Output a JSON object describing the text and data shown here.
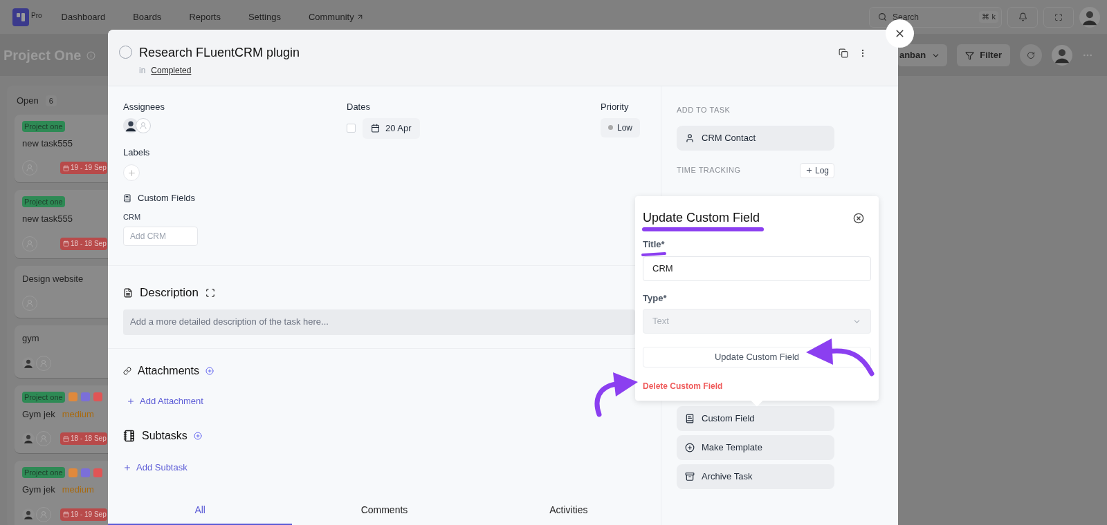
{
  "nav": {
    "logo_badge": "Pro",
    "items": [
      {
        "label": "Dashboard",
        "external": false
      },
      {
        "label": "Boards",
        "external": false
      },
      {
        "label": "Reports",
        "external": false
      },
      {
        "label": "Settings",
        "external": false
      },
      {
        "label": "Community",
        "external": true
      }
    ],
    "search": {
      "placeholder": "Search",
      "shortcut": "⌘ k"
    }
  },
  "project": {
    "title": "Project One",
    "view": "anban",
    "filter": "Filter"
  },
  "board": {
    "column": {
      "title": "Open",
      "count": "6",
      "cards": [
        {
          "tag": "Project one",
          "title": "new task555",
          "date": "19 - 19 Sep",
          "assigned": false
        },
        {
          "tag": "Project one",
          "title": "new task555",
          "date": "18 - 18 Sep",
          "assigned": false
        },
        {
          "title": "Design website",
          "assigned": false
        },
        {
          "title": "gym",
          "assigned": true
        },
        {
          "tag": "Project one",
          "labels": [
            {
              "color": "#e0893c"
            },
            {
              "color": "#7b6fd8"
            },
            {
              "color": "#e05555"
            }
          ],
          "title": "Gym jek",
          "priority": "medium",
          "date": "18 - 18 Sep",
          "assigned": true
        },
        {
          "tag": "Project one",
          "labels": [
            {
              "color": "#e0893c"
            },
            {
              "color": "#7b6fd8"
            },
            {
              "color": "#e05555"
            }
          ],
          "title": "Gym jek",
          "priority": "medium",
          "date": "19 - 19 Sep",
          "assigned": true
        }
      ]
    }
  },
  "task": {
    "title": "Research FLuentCRM plugin",
    "completed": false,
    "list_prefix": "in",
    "list": "Completed",
    "assignees": {
      "label": "Assignees",
      "assigned": true
    },
    "dates": {
      "label": "Dates",
      "checked": false,
      "value": "20 Apr"
    },
    "priority": {
      "label": "Priority",
      "value": "Low"
    },
    "labels": {
      "label": "Labels"
    },
    "custom_fields": {
      "heading": "Custom Fields",
      "field_label": "CRM",
      "placeholder": "Add CRM"
    },
    "description": {
      "heading": "Description",
      "placeholder": "Add a more detailed description of the task here..."
    },
    "attachments": {
      "heading": "Attachments",
      "action": "Add Attachment"
    },
    "subtasks": {
      "heading": "Subtasks",
      "action": "Add Subtask"
    },
    "tabs": [
      {
        "label": "All",
        "selected": true
      },
      {
        "label": "Comments",
        "selected": false
      },
      {
        "label": "Activities",
        "selected": false
      }
    ]
  },
  "sidebar": {
    "add_heading": "ADD TO TASK",
    "add_items": [
      {
        "kind": "contact",
        "label": "CRM Contact"
      }
    ],
    "time_heading": "TIME TRACKING",
    "log_button": "Log",
    "actions": [
      {
        "kind": "custom-field",
        "label": "Custom Field"
      },
      {
        "kind": "template",
        "label": "Make Template"
      },
      {
        "kind": "archive",
        "label": "Archive Task"
      }
    ]
  },
  "popover": {
    "title": "Update Custom Field",
    "title_label": "Title*",
    "title_value": "CRM",
    "type_label": "Type*",
    "type_value": "Text",
    "type_disabled": true,
    "submit": "Update Custom Field",
    "delete": "Delete Custom Field"
  }
}
